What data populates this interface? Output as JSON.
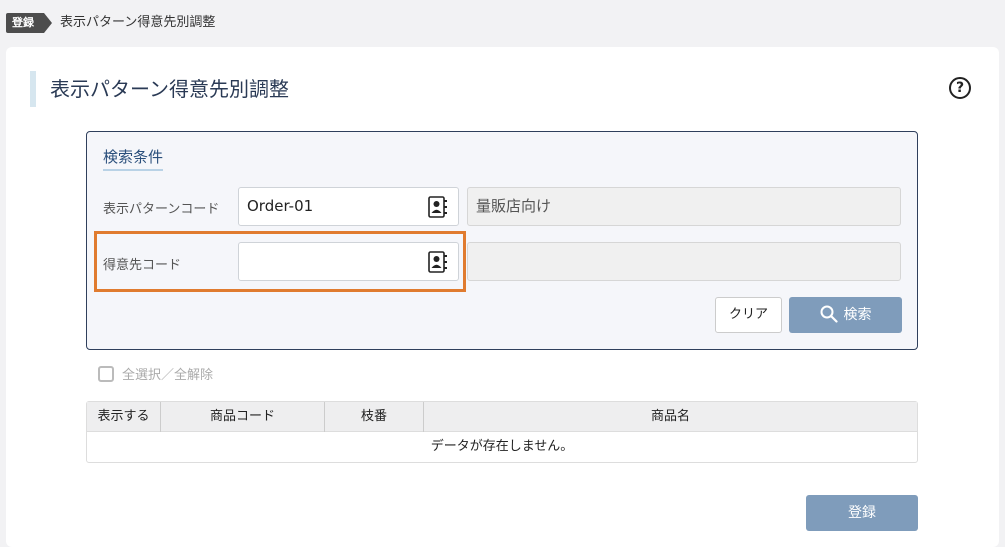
{
  "breadcrumb": {
    "tag": "登録",
    "title": "表示パターン得意先別調整"
  },
  "page": {
    "title": "表示パターン得意先別調整",
    "help_icon": "?"
  },
  "search": {
    "panel_title": "検索条件",
    "pattern_code": {
      "label": "表示パターンコード",
      "value": "Order-01",
      "name": "量販店向け"
    },
    "customer_code": {
      "label": "得意先コード",
      "value": "",
      "name": ""
    },
    "clear_label": "クリア",
    "search_label": "検索"
  },
  "select_all_label": "全選択／全解除",
  "table": {
    "headers": [
      "表示する",
      "商品コード",
      "枝番",
      "商品名"
    ],
    "empty_message": "データが存在しません。"
  },
  "register_label": "登録",
  "colors": {
    "accent": "#7f9cbb",
    "highlight": "#e07b2f",
    "panel_border": "#2f3f5c"
  }
}
